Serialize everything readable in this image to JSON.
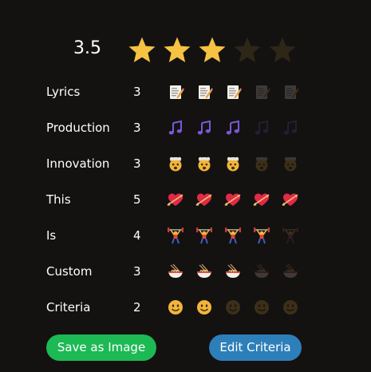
{
  "overall": {
    "score": "3.5",
    "rating": 3.5,
    "max_stars": 5,
    "filled_stars": 3,
    "star_color": "#f5c242",
    "star_empty_color": "#2e2617"
  },
  "criteria": [
    {
      "label": "Lyrics",
      "value": "3",
      "rating": 3,
      "max": 5,
      "icon": "memo-icon"
    },
    {
      "label": "Production",
      "value": "3",
      "rating": 3,
      "max": 5,
      "icon": "music-note-icon"
    },
    {
      "label": "Innovation",
      "value": "3",
      "rating": 3,
      "max": 5,
      "icon": "exploding-head-icon"
    },
    {
      "label": "This",
      "value": "5",
      "rating": 5,
      "max": 5,
      "icon": "heart-arrow-icon"
    },
    {
      "label": "Is",
      "value": "4",
      "rating": 4,
      "max": 5,
      "icon": "weight-lifter-icon"
    },
    {
      "label": "Custom",
      "value": "3",
      "rating": 3,
      "max": 5,
      "icon": "noodle-bowl-icon"
    },
    {
      "label": "Criteria",
      "value": "2",
      "rating": 2,
      "max": 5,
      "icon": "smiley-face-icon"
    }
  ],
  "buttons": {
    "save_label": "Save as Image",
    "edit_label": "Edit Criteria"
  },
  "colors": {
    "background": "#141111",
    "save_button": "#1db954",
    "edit_button": "#2d7fb9"
  }
}
